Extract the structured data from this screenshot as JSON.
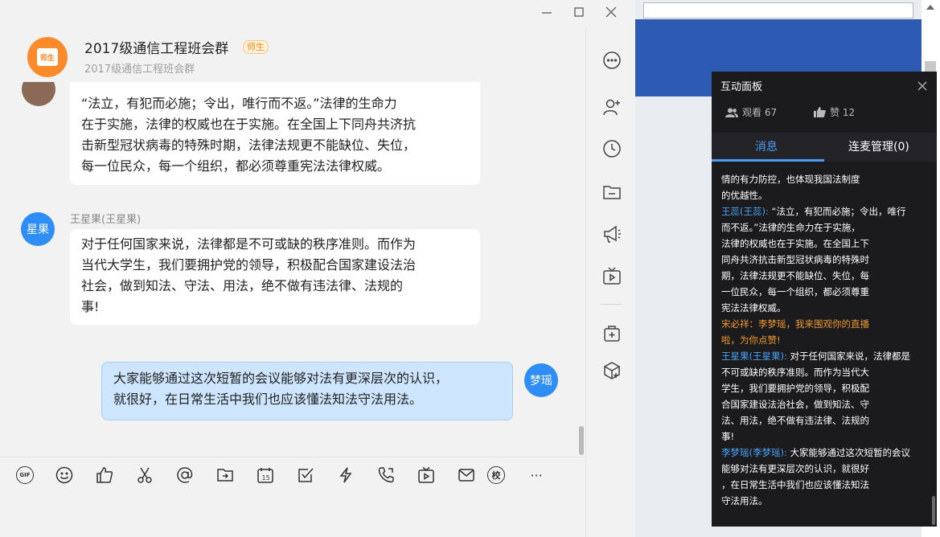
{
  "window": {
    "minimize_label": "minimize",
    "maximize_label": "maximize",
    "close_label": "close"
  },
  "chat": {
    "group_name": "2017级通信工程班会群",
    "role_badge": "师生",
    "group_subtitle": "2017级通信工程班会群",
    "avatar_text": "师生"
  },
  "messages": [
    {
      "sender": "",
      "avatar": "",
      "text": "“法立，有犯而必施；令出，唯行而不返。”法律的生命力在于实施，法律的权威也在于实施。在全国上下同舟共济抗击新型冠状病毒的特殊时期，法律法规更不能缺位、失位，每一位民众，每一个组织，都必须尊重宪法法律权威。",
      "lines": [
        "“法立，有犯而必施；令出，唯行而不返。”法律的生命力",
        "在于实施，法律的权威也在于实施。在全国上下同舟共济抗",
        "击新型冠状病毒的特殊时期，法律法规更不能缺位、失位，",
        "每一位民众，每一个组织，都必须尊重宪法法律权威。"
      ]
    },
    {
      "sender": "王星果(王星果)",
      "avatar": "星果",
      "lines": [
        "对于任何国家来说，法律都是不可或缺的秩序准则。而作为",
        "当代大学生，我们要拥护党的领导，积极配合国家建设法治",
        "社会，做到知法、守法、用法，绝不做有违法律、法规的",
        "事!"
      ]
    },
    {
      "sender": "",
      "avatar": "梦瑶",
      "lines": [
        "大家能够通过这次短暂的会议能够对法有更深层次的认识，",
        "就很好，在日常生活中我们也应该懂法知法守法用法。"
      ]
    }
  ],
  "toolbar": {
    "gif": "GIF",
    "school": "校",
    "more": "···"
  },
  "panel": {
    "title": "互动面板",
    "views_label": "观看 67",
    "likes_label": "赞 12",
    "tab_messages": "消息",
    "tab_mic": "连麦管理(0)",
    "lines": [
      {
        "text": "情的有力防控，也体现我国法制度",
        "color": "white"
      },
      {
        "text": "的优越性。",
        "color": "white"
      },
      {
        "name": "王蕊(王蕊):",
        "text": " “法立，有犯而必施；令出，唯行",
        "color": "white"
      },
      {
        "text": "而不返。”法律的生命力在于实施，",
        "color": "white"
      },
      {
        "text": "法律的权威也在于实施。在全国上下",
        "color": "white"
      },
      {
        "text": "同舟共济抗击新型冠状病毒的特殊时",
        "color": "white"
      },
      {
        "text": "期，法律法规更不能缺位、失位，每",
        "color": "white"
      },
      {
        "text": "一位民众，每一个组织，都必须尊重",
        "color": "white"
      },
      {
        "text": "宪法法律权威。",
        "color": "white"
      },
      {
        "text": "宋必祥：李梦瑶，我来围观你的直播",
        "color": "orange"
      },
      {
        "text": "啦，为你点赞!",
        "color": "orange"
      },
      {
        "name": "王星果(王星果):",
        "text": " 对于任何国家来说，法律都是",
        "color": "white"
      },
      {
        "text": "不可或缺的秩序准则。而作为当代大",
        "color": "white"
      },
      {
        "text": "学生，我们要拥护党的领导，积极配",
        "color": "white"
      },
      {
        "text": "合国家建设法治社会，做到知法、守",
        "color": "white"
      },
      {
        "text": "法、用法，绝不做有违法律、法规的",
        "color": "white"
      },
      {
        "text": "事!",
        "color": "white"
      },
      {
        "name": "李梦瑶(李梦瑶):",
        "text": " 大家能够通过这次短暂的会议",
        "color": "white"
      },
      {
        "text": "能够对法有更深层次的认识，就很好",
        "color": "white"
      },
      {
        "text": "，在日常生活中我们也应该懂法知法",
        "color": "white"
      },
      {
        "text": "守法用法。",
        "color": "white"
      }
    ]
  },
  "colors": {
    "accent": "#4a9cf5",
    "self_bubble": "#cde6fd",
    "panel_bg": "#1b1b1d",
    "orange": "#f09a2e"
  },
  "icons": {
    "side": [
      "more-icon",
      "add-member-icon",
      "history-icon",
      "folder-icon",
      "announcement-icon",
      "live-icon",
      "add-app-icon",
      "box-icon"
    ],
    "input": [
      "gif-icon",
      "emoji-icon",
      "like-icon",
      "scissors-icon",
      "mention-icon",
      "file-icon",
      "calendar-icon",
      "task-icon",
      "lightning-icon",
      "phone-icon",
      "video-icon",
      "mail-icon",
      "school-icon",
      "more-icon"
    ]
  }
}
